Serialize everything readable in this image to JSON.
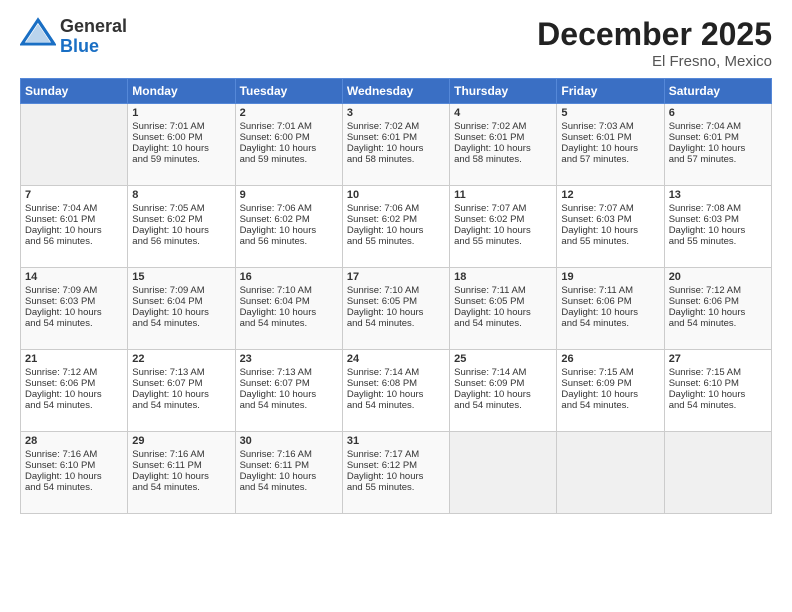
{
  "logo": {
    "general": "General",
    "blue": "Blue"
  },
  "header": {
    "month_title": "December 2025",
    "location": "El Fresno, Mexico"
  },
  "calendar": {
    "days_of_week": [
      "Sunday",
      "Monday",
      "Tuesday",
      "Wednesday",
      "Thursday",
      "Friday",
      "Saturday"
    ],
    "weeks": [
      [
        {
          "day": "",
          "content": ""
        },
        {
          "day": "1",
          "content": "Sunrise: 7:01 AM\nSunset: 6:00 PM\nDaylight: 10 hours\nand 59 minutes."
        },
        {
          "day": "2",
          "content": "Sunrise: 7:01 AM\nSunset: 6:00 PM\nDaylight: 10 hours\nand 59 minutes."
        },
        {
          "day": "3",
          "content": "Sunrise: 7:02 AM\nSunset: 6:01 PM\nDaylight: 10 hours\nand 58 minutes."
        },
        {
          "day": "4",
          "content": "Sunrise: 7:02 AM\nSunset: 6:01 PM\nDaylight: 10 hours\nand 58 minutes."
        },
        {
          "day": "5",
          "content": "Sunrise: 7:03 AM\nSunset: 6:01 PM\nDaylight: 10 hours\nand 57 minutes."
        },
        {
          "day": "6",
          "content": "Sunrise: 7:04 AM\nSunset: 6:01 PM\nDaylight: 10 hours\nand 57 minutes."
        }
      ],
      [
        {
          "day": "7",
          "content": "Sunrise: 7:04 AM\nSunset: 6:01 PM\nDaylight: 10 hours\nand 56 minutes."
        },
        {
          "day": "8",
          "content": "Sunrise: 7:05 AM\nSunset: 6:02 PM\nDaylight: 10 hours\nand 56 minutes."
        },
        {
          "day": "9",
          "content": "Sunrise: 7:06 AM\nSunset: 6:02 PM\nDaylight: 10 hours\nand 56 minutes."
        },
        {
          "day": "10",
          "content": "Sunrise: 7:06 AM\nSunset: 6:02 PM\nDaylight: 10 hours\nand 55 minutes."
        },
        {
          "day": "11",
          "content": "Sunrise: 7:07 AM\nSunset: 6:02 PM\nDaylight: 10 hours\nand 55 minutes."
        },
        {
          "day": "12",
          "content": "Sunrise: 7:07 AM\nSunset: 6:03 PM\nDaylight: 10 hours\nand 55 minutes."
        },
        {
          "day": "13",
          "content": "Sunrise: 7:08 AM\nSunset: 6:03 PM\nDaylight: 10 hours\nand 55 minutes."
        }
      ],
      [
        {
          "day": "14",
          "content": "Sunrise: 7:09 AM\nSunset: 6:03 PM\nDaylight: 10 hours\nand 54 minutes."
        },
        {
          "day": "15",
          "content": "Sunrise: 7:09 AM\nSunset: 6:04 PM\nDaylight: 10 hours\nand 54 minutes."
        },
        {
          "day": "16",
          "content": "Sunrise: 7:10 AM\nSunset: 6:04 PM\nDaylight: 10 hours\nand 54 minutes."
        },
        {
          "day": "17",
          "content": "Sunrise: 7:10 AM\nSunset: 6:05 PM\nDaylight: 10 hours\nand 54 minutes."
        },
        {
          "day": "18",
          "content": "Sunrise: 7:11 AM\nSunset: 6:05 PM\nDaylight: 10 hours\nand 54 minutes."
        },
        {
          "day": "19",
          "content": "Sunrise: 7:11 AM\nSunset: 6:06 PM\nDaylight: 10 hours\nand 54 minutes."
        },
        {
          "day": "20",
          "content": "Sunrise: 7:12 AM\nSunset: 6:06 PM\nDaylight: 10 hours\nand 54 minutes."
        }
      ],
      [
        {
          "day": "21",
          "content": "Sunrise: 7:12 AM\nSunset: 6:06 PM\nDaylight: 10 hours\nand 54 minutes."
        },
        {
          "day": "22",
          "content": "Sunrise: 7:13 AM\nSunset: 6:07 PM\nDaylight: 10 hours\nand 54 minutes."
        },
        {
          "day": "23",
          "content": "Sunrise: 7:13 AM\nSunset: 6:07 PM\nDaylight: 10 hours\nand 54 minutes."
        },
        {
          "day": "24",
          "content": "Sunrise: 7:14 AM\nSunset: 6:08 PM\nDaylight: 10 hours\nand 54 minutes."
        },
        {
          "day": "25",
          "content": "Sunrise: 7:14 AM\nSunset: 6:09 PM\nDaylight: 10 hours\nand 54 minutes."
        },
        {
          "day": "26",
          "content": "Sunrise: 7:15 AM\nSunset: 6:09 PM\nDaylight: 10 hours\nand 54 minutes."
        },
        {
          "day": "27",
          "content": "Sunrise: 7:15 AM\nSunset: 6:10 PM\nDaylight: 10 hours\nand 54 minutes."
        }
      ],
      [
        {
          "day": "28",
          "content": "Sunrise: 7:16 AM\nSunset: 6:10 PM\nDaylight: 10 hours\nand 54 minutes."
        },
        {
          "day": "29",
          "content": "Sunrise: 7:16 AM\nSunset: 6:11 PM\nDaylight: 10 hours\nand 54 minutes."
        },
        {
          "day": "30",
          "content": "Sunrise: 7:16 AM\nSunset: 6:11 PM\nDaylight: 10 hours\nand 54 minutes."
        },
        {
          "day": "31",
          "content": "Sunrise: 7:17 AM\nSunset: 6:12 PM\nDaylight: 10 hours\nand 55 minutes."
        },
        {
          "day": "",
          "content": ""
        },
        {
          "day": "",
          "content": ""
        },
        {
          "day": "",
          "content": ""
        }
      ]
    ]
  }
}
